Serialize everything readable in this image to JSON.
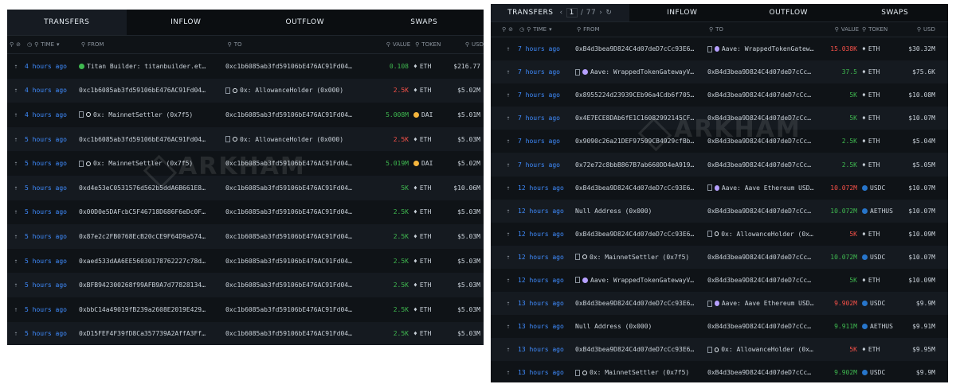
{
  "left": {
    "tabs": [
      "TRANSFERS",
      "INFLOW",
      "OUTFLOW",
      "SWAPS"
    ],
    "headers": {
      "time": "TIME",
      "from": "FROM",
      "to": "TO",
      "value": "VALUE",
      "token": "TOKEN",
      "usd": "USD"
    },
    "watermark": "ARKHAM",
    "rows": [
      {
        "time": "4 hours ago",
        "from": "Titan Builder: titanbuilder.et…",
        "to": "0xc1b6085ab3fd59106bE476AC91Fd04…",
        "value": "0.108",
        "value_color": "green",
        "token": "ETH",
        "usd": "$216.77"
      },
      {
        "time": "4 hours ago",
        "from": "0xc1b6085ab3fd59106bE476AC91Fd04…",
        "to": "0x: AllowanceHolder (0x000)",
        "value": "2.5K",
        "value_color": "red",
        "token": "ETH",
        "usd": "$5.02M"
      },
      {
        "time": "4 hours ago",
        "from": "0x: MainnetSettler (0x7f5)",
        "to": "0xc1b6085ab3fd59106bE476AC91Fd04…",
        "value": "5.008M",
        "value_color": "green",
        "token": "DAI",
        "usd": "$5.01M"
      },
      {
        "time": "5 hours ago",
        "from": "0xc1b6085ab3fd59106bE476AC91Fd04…",
        "to": "0x: AllowanceHolder (0x000)",
        "value": "2.5K",
        "value_color": "red",
        "token": "ETH",
        "usd": "$5.03M"
      },
      {
        "time": "5 hours ago",
        "from": "0x: MainnetSettler (0x7f5)",
        "to": "0xc1b6085ab3fd59106bE476AC91Fd04…",
        "value": "5.019M",
        "value_color": "green",
        "token": "DAI",
        "usd": "$5.02M"
      },
      {
        "time": "5 hours ago",
        "from": "0xd4e53eC0531576d562b5ddA6B661E8…",
        "to": "0xc1b6085ab3fd59106bE476AC91Fd04…",
        "value": "5K",
        "value_color": "green",
        "token": "ETH",
        "usd": "$10.06M"
      },
      {
        "time": "5 hours ago",
        "from": "0x00D0e5DAFcbC5F46718D686F6eDc0F…",
        "to": "0xc1b6085ab3fd59106bE476AC91Fd04…",
        "value": "2.5K",
        "value_color": "green",
        "token": "ETH",
        "usd": "$5.03M"
      },
      {
        "time": "5 hours ago",
        "from": "0x87e2c2FB0768EcB20cCE9F64D9a574…",
        "to": "0xc1b6085ab3fd59106bE476AC91Fd04…",
        "value": "2.5K",
        "value_color": "green",
        "token": "ETH",
        "usd": "$5.03M"
      },
      {
        "time": "5 hours ago",
        "from": "0xaed533dAA6EE56030178762227c78d…",
        "to": "0xc1b6085ab3fd59106bE476AC91Fd04…",
        "value": "2.5K",
        "value_color": "green",
        "token": "ETH",
        "usd": "$5.03M"
      },
      {
        "time": "5 hours ago",
        "from": "0xBFB942300268f99AFB9A7d77828134…",
        "to": "0xc1b6085ab3fd59106bE476AC91Fd04…",
        "value": "2.5K",
        "value_color": "green",
        "token": "ETH",
        "usd": "$5.03M"
      },
      {
        "time": "5 hours ago",
        "from": "0xbbC14a49019fB239a2608E2019E429…",
        "to": "0xc1b6085ab3fd59106bE476AC91Fd04…",
        "value": "2.5K",
        "value_color": "green",
        "token": "ETH",
        "usd": "$5.03M"
      },
      {
        "time": "5 hours ago",
        "from": "0xD15FEF4F39fD8Ca357739A2AffA3Ff…",
        "to": "0xc1b6085ab3fd59106bE476AC91Fd04…",
        "value": "2.5K",
        "value_color": "green",
        "token": "ETH",
        "usd": "$5.03M"
      }
    ]
  },
  "right": {
    "tabs": [
      "TRANSFERS",
      "INFLOW",
      "OUTFLOW",
      "SWAPS"
    ],
    "page": "1",
    "page_total": "/ 77",
    "headers": {
      "time": "TIME",
      "from": "FROM",
      "to": "TO",
      "value": "VALUE",
      "token": "TOKEN",
      "usd": "USD"
    },
    "watermark": "ARKHAM",
    "rows": [
      {
        "time": "7 hours ago",
        "from": "0xB4d3bea9D824C4d07deD7cCc93E6…",
        "to": "Aave: WrappedTokenGatewayV…",
        "value": "15.038K",
        "value_color": "red",
        "token": "ETH",
        "usd": "$30.32M"
      },
      {
        "time": "7 hours ago",
        "from": "Aave: WrappedTokenGatewayV…",
        "to": "0xB4d3bea9D824C4d07deD7cCc93E6…",
        "value": "37.5",
        "value_color": "green",
        "token": "ETH",
        "usd": "$75.6K"
      },
      {
        "time": "7 hours ago",
        "from": "0x8955224d23939CEb96a4Cdb6f705…",
        "to": "0xB4d3bea9D824C4d07deD7cCc93E6…",
        "value": "5K",
        "value_color": "green",
        "token": "ETH",
        "usd": "$10.08M"
      },
      {
        "time": "7 hours ago",
        "from": "0x4E7ECE8DAb6fE1C16082992145CF…",
        "to": "0xB4d3bea9D824C4d07deD7cCc93E6…",
        "value": "5K",
        "value_color": "green",
        "token": "ETH",
        "usd": "$10.07M"
      },
      {
        "time": "7 hours ago",
        "from": "0x9090c26a21DEF97509CB4929cfBb…",
        "to": "0xB4d3bea9D824C4d07deD7cCc93E6…",
        "value": "2.5K",
        "value_color": "green",
        "token": "ETH",
        "usd": "$5.04M"
      },
      {
        "time": "7 hours ago",
        "from": "0x72e72c8bbB867B7ab660DD4eA919…",
        "to": "0xB4d3bea9D824C4d07deD7cCc93E6…",
        "value": "2.5K",
        "value_color": "green",
        "token": "ETH",
        "usd": "$5.05M"
      },
      {
        "time": "12 hours ago",
        "from": "0xB4d3bea9D824C4d07deD7cCc93E6…",
        "to": "Aave: Aave Ethereum USDC (…",
        "value": "10.072M",
        "value_color": "red",
        "token": "USDC",
        "usd": "$10.07M"
      },
      {
        "time": "12 hours ago",
        "from": "Null Address (0x000)",
        "to": "0xB4d3bea9D824C4d07deD7cCc93E6…",
        "value": "10.072M",
        "value_color": "green",
        "token": "AETHUS",
        "usd": "$10.07M"
      },
      {
        "time": "12 hours ago",
        "from": "0xB4d3bea9D824C4d07deD7cCc93E6…",
        "to": "0x: AllowanceHolder (0x000)",
        "value": "5K",
        "value_color": "red",
        "token": "ETH",
        "usd": "$10.09M"
      },
      {
        "time": "12 hours ago",
        "from": "0x: MainnetSettler (0x7f5)",
        "to": "0xB4d3bea9D824C4d07deD7cCc93E6…",
        "value": "10.072M",
        "value_color": "green",
        "token": "USDC",
        "usd": "$10.07M"
      },
      {
        "time": "12 hours ago",
        "from": "Aave: WrappedTokenGatewayV…",
        "to": "0xB4d3bea9D824C4d07deD7cCc93E6…",
        "value": "5K",
        "value_color": "green",
        "token": "ETH",
        "usd": "$10.09M"
      },
      {
        "time": "13 hours ago",
        "from": "0xB4d3bea9D824C4d07deD7cCc93E6…",
        "to": "Aave: Aave Ethereum USDC (…",
        "value": "9.902M",
        "value_color": "red",
        "token": "USDC",
        "usd": "$9.9M"
      },
      {
        "time": "13 hours ago",
        "from": "Null Address (0x000)",
        "to": "0xB4d3bea9D824C4d07deD7cCc93E6…",
        "value": "9.911M",
        "value_color": "green",
        "token": "AETHUS",
        "usd": "$9.91M"
      },
      {
        "time": "13 hours ago",
        "from": "0xB4d3bea9D824C4d07deD7cCc93E6…",
        "to": "0x: AllowanceHolder (0x000)",
        "value": "5K",
        "value_color": "red",
        "token": "ETH",
        "usd": "$9.95M"
      },
      {
        "time": "13 hours ago",
        "from": "0x: MainnetSettler (0x7f5)",
        "to": "0xB4d3bea9D824C4d07deD7cCc93E6…",
        "value": "9.902M",
        "value_color": "green",
        "token": "USDC",
        "usd": "$9.9M"
      }
    ]
  }
}
